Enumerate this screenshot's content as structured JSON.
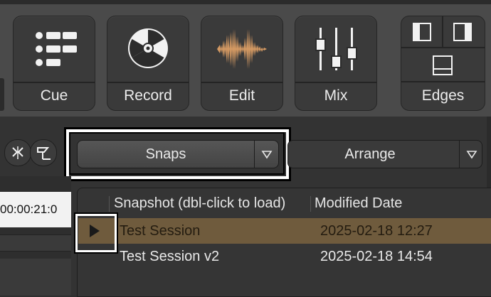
{
  "toolbar": {
    "modes": [
      {
        "label": "Cue",
        "icon": "cue-list-icon"
      },
      {
        "label": "Record",
        "icon": "record-reel-icon"
      },
      {
        "label": "Edit",
        "icon": "waveform-icon"
      },
      {
        "label": "Mix",
        "icon": "faders-icon"
      }
    ],
    "edges_label": "Edges"
  },
  "tabs": {
    "snaps_label": "Snaps",
    "arrange_label": "Arrange"
  },
  "timeline": {
    "timecode": "00:00:21:0"
  },
  "snapshots": {
    "columns": [
      "Snapshot (dbl-click to load)",
      "Modified Date"
    ],
    "rows": [
      {
        "name": "Test Session",
        "date": "2025-02-18 12:27",
        "selected": true
      },
      {
        "name": "Test Session v2",
        "date": "2025-02-18 14:54",
        "selected": false
      }
    ]
  },
  "colors": {
    "selected_row": "#6f5b3d",
    "waveform": "#d59a63"
  }
}
